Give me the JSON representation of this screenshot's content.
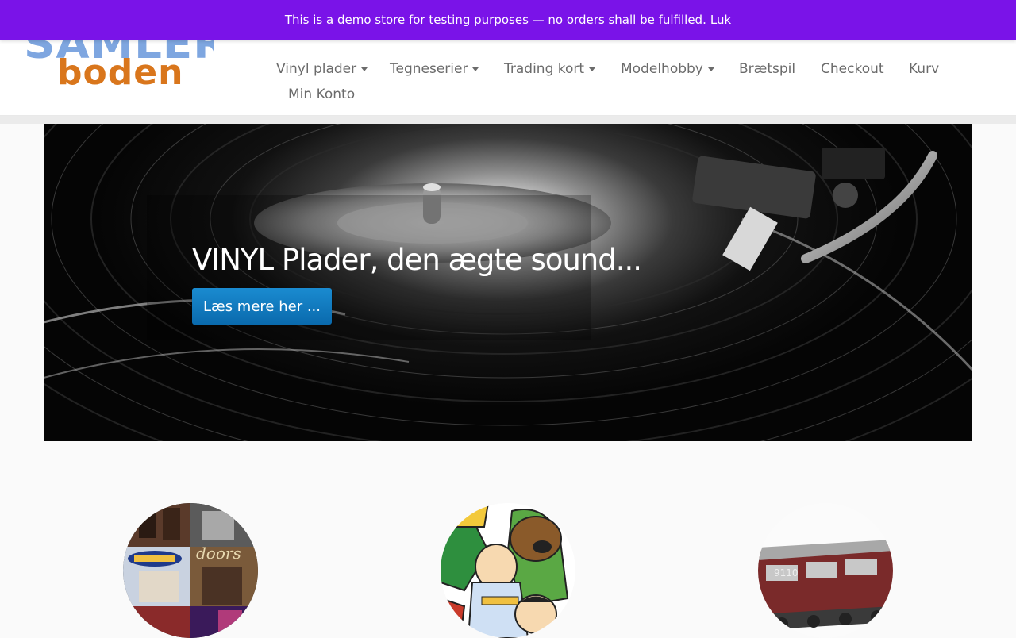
{
  "demo_banner": {
    "message": "This is a demo store for testing purposes — no orders shall be fulfilled.",
    "dismiss_label": "Luk",
    "background": "#7a13e8"
  },
  "logo": {
    "top_text": "SAMLER",
    "bottom_text": "boden"
  },
  "nav": {
    "items": [
      {
        "label": "Vinyl plader",
        "dropdown": true
      },
      {
        "label": "Tegneserier",
        "dropdown": true
      },
      {
        "label": "Trading kort",
        "dropdown": true
      },
      {
        "label": "Modelhobby",
        "dropdown": true
      },
      {
        "label": "Brætspil",
        "dropdown": false
      },
      {
        "label": "Checkout",
        "dropdown": false
      },
      {
        "label": "Kurv",
        "dropdown": false
      },
      {
        "label": "Min Konto",
        "dropdown": false
      }
    ]
  },
  "hero": {
    "title": "VINYL Plader, den ægte sound...",
    "button_label": "Læs mere her ...",
    "button_color": "#0a6aad"
  },
  "features": [
    {
      "name": "vinyl-records",
      "icon": "album-covers-image"
    },
    {
      "name": "comics",
      "icon": "comic-characters-image"
    },
    {
      "name": "model-hobby",
      "icon": "model-train-image"
    }
  ]
}
